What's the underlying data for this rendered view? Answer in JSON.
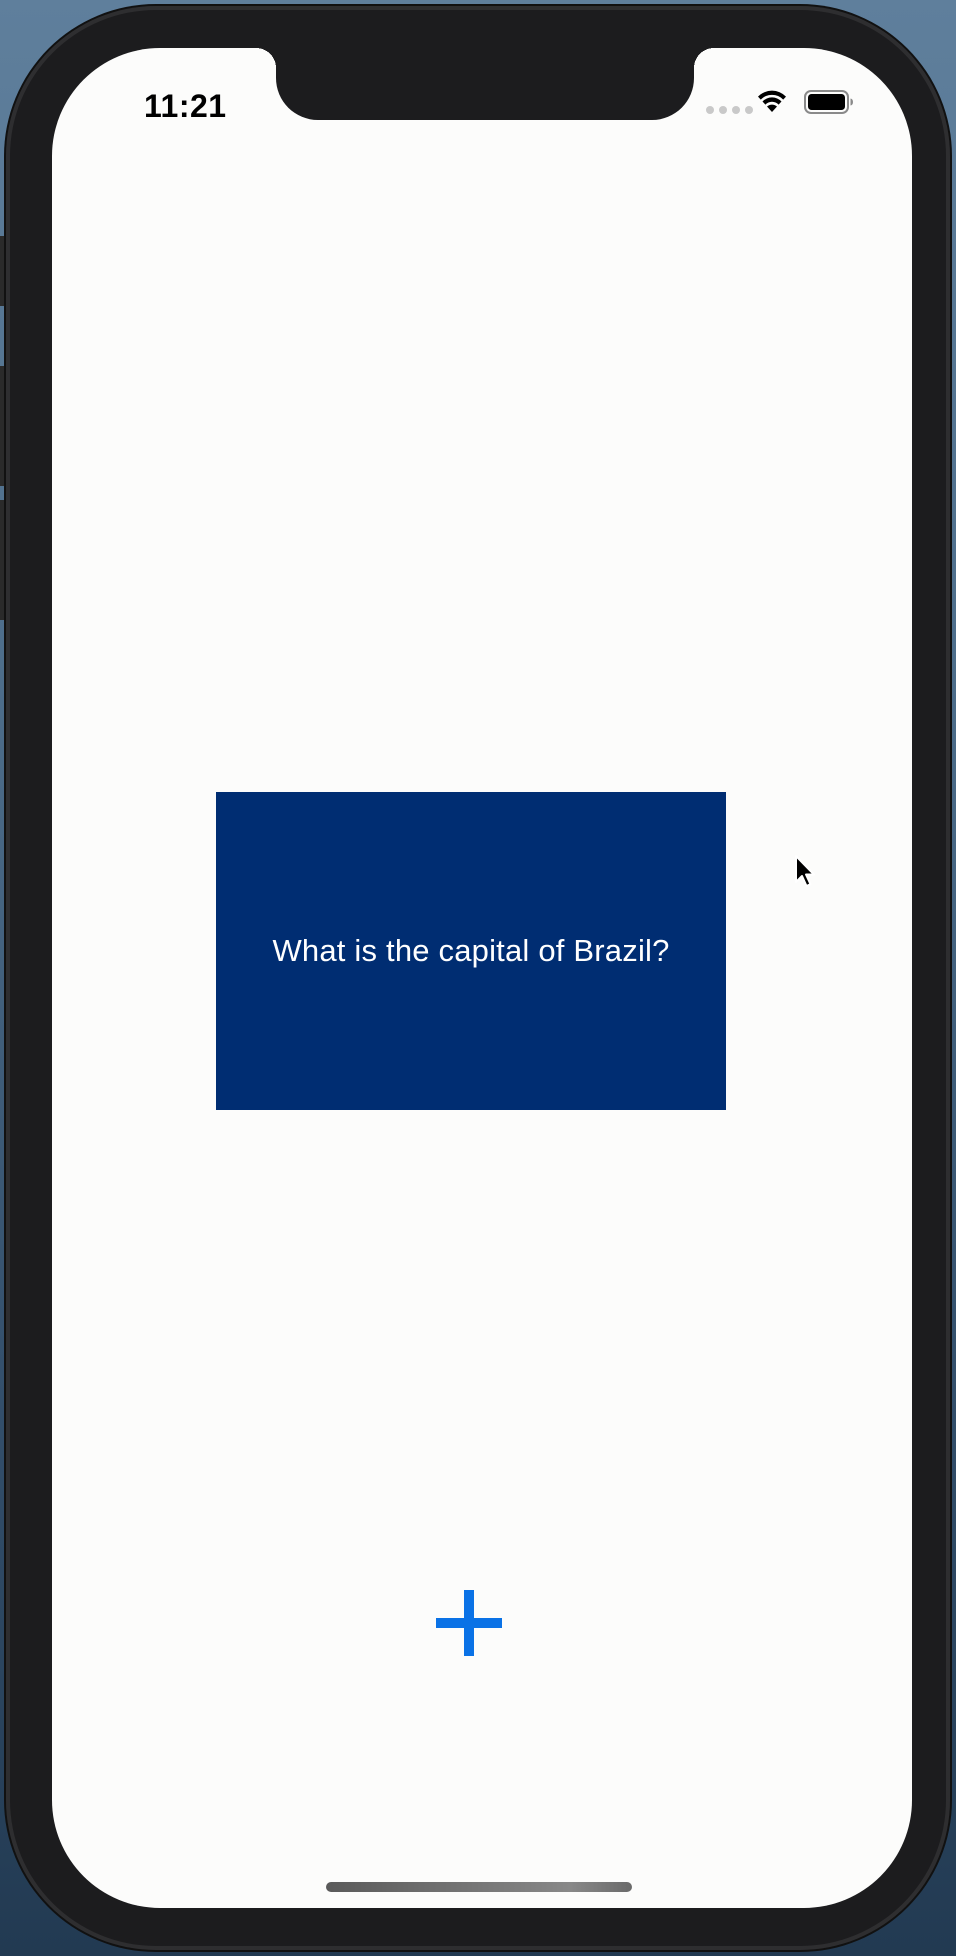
{
  "status_bar": {
    "time": "11:21"
  },
  "flashcard": {
    "question": "What is the capital of Brazil?"
  },
  "icons": {
    "add": "plus-icon",
    "wifi": "wifi-icon",
    "battery": "battery-icon",
    "signal": "signal-dots-icon",
    "cursor": "mouse-pointer-icon"
  },
  "colors": {
    "card_background": "#002d72",
    "card_text": "#ffffff",
    "accent": "#0a72e6",
    "screen_background": "#fcfcfb"
  }
}
